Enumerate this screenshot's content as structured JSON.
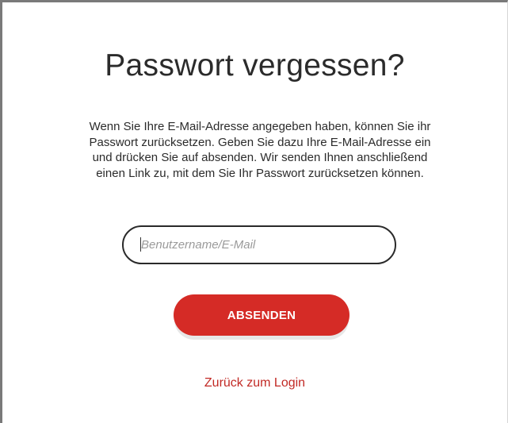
{
  "page": {
    "title": "Passwort vergessen?",
    "intro_lines": [
      "Wenn Sie Ihre E-Mail-Adresse angegeben haben, können Sie ihr",
      "Passwort zurücksetzen. Geben Sie dazu Ihre E-Mail-Adresse ein",
      "und drücken Sie auf absenden. Wir senden Ihnen anschließend",
      "einen Link zu, mit dem Sie Ihr Passwort zurücksetzen können."
    ]
  },
  "form": {
    "email_placeholder": "Benutzername/E-Mail",
    "email_value": "",
    "submit_label": "ABSENDEN"
  },
  "links": {
    "back_to_login": "Zurück zum Login"
  },
  "colors": {
    "accent": "#d52b26",
    "link": "#c22a25",
    "text": "#2b2b2b"
  }
}
